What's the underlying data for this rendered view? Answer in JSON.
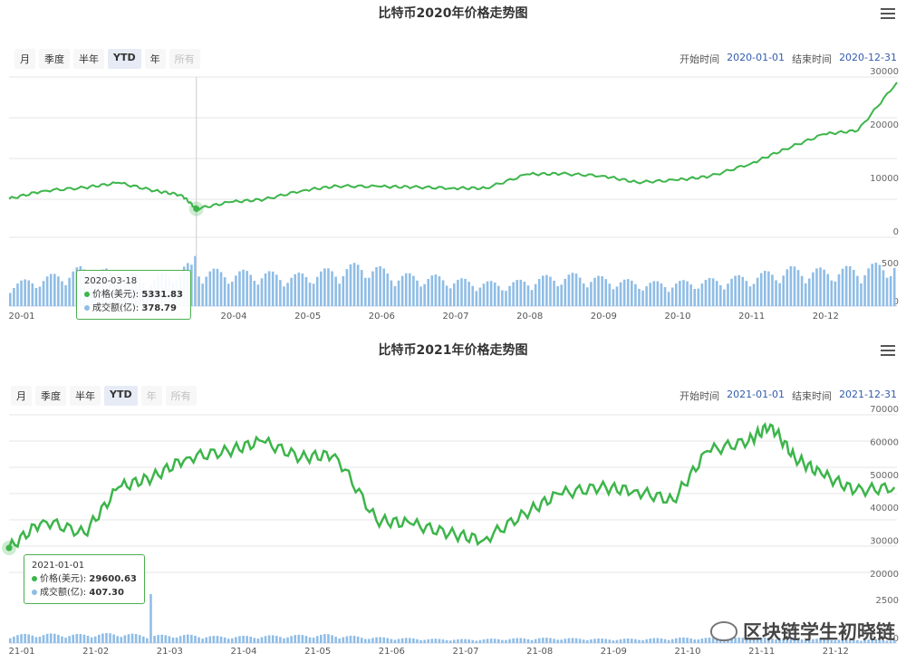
{
  "colors": {
    "price": "#3cb54a",
    "volume": "#8fbde6",
    "accent": "#335cad"
  },
  "charts": [
    {
      "title": "比特币2020年价格走势图",
      "range_buttons": [
        "月",
        "季度",
        "半年",
        "YTD",
        "年",
        "所有"
      ],
      "active_button": "YTD",
      "disabled_buttons": [
        "所有"
      ],
      "start_label": "开始时间",
      "start_value": "2020-01-01",
      "end_label": "结束时间",
      "end_value": "2020-12-31",
      "tooltip": {
        "date": "2020-03-18",
        "price_label": "价格(美元):",
        "price_value": "5331.83",
        "volume_label": "成交额(亿):",
        "volume_value": "378.79"
      }
    },
    {
      "title": "比特币2021年价格走势图",
      "range_buttons": [
        "月",
        "季度",
        "半年",
        "YTD",
        "年",
        "所有"
      ],
      "active_button": "YTD",
      "disabled_buttons": [
        "年",
        "所有"
      ],
      "start_label": "开始时间",
      "start_value": "2021-01-01",
      "end_label": "结束时间",
      "end_value": "2021-12-31",
      "tooltip": {
        "date": "2021-01-01",
        "price_label": "价格(美元):",
        "price_value": "29600.63",
        "volume_label": "成交额(亿):",
        "volume_value": "407.30"
      }
    }
  ],
  "chart_data": [
    {
      "type": "line",
      "title": "比特币2020年价格走势图",
      "x": [
        "2020-01-01",
        "2020-01-15",
        "2020-02-01",
        "2020-02-15",
        "2020-03-01",
        "2020-03-12",
        "2020-03-18",
        "2020-04-01",
        "2020-04-15",
        "2020-05-01",
        "2020-05-15",
        "2020-06-01",
        "2020-06-15",
        "2020-07-01",
        "2020-07-15",
        "2020-08-01",
        "2020-08-15",
        "2020-09-01",
        "2020-09-15",
        "2020-10-01",
        "2020-10-15",
        "2020-11-01",
        "2020-11-15",
        "2020-12-01",
        "2020-12-15",
        "2020-12-31"
      ],
      "series": [
        {
          "values": [
            7200,
            8700,
            9300,
            10200,
            8700,
            7900,
            5331.83,
            6600,
            7100,
            8800,
            9600,
            9500,
            9400,
            9200,
            9200,
            11800,
            11900,
            11500,
            10300,
            10700,
            11400,
            13800,
            16500,
            19300,
            20000,
            29000
          ]
        }
      ],
      "volume_values": [
        250,
        320,
        420,
        380,
        300,
        450,
        378.79,
        380,
        340,
        400,
        470,
        350,
        330,
        280,
        250,
        320,
        350,
        300,
        260,
        270,
        300,
        340,
        420,
        400,
        430,
        480
      ],
      "ylim": [
        0,
        30000
      ],
      "price_ticks": [
        0,
        10000,
        20000,
        30000
      ],
      "volume_ticks": [
        0,
        500
      ],
      "x_tick_labels": [
        "20-01",
        "20-04",
        "20-05",
        "20-06",
        "20-07",
        "20-08",
        "20-09",
        "20-10",
        "20-11",
        "20-12"
      ]
    },
    {
      "type": "line",
      "title": "比特币2021年价格走势图",
      "x": [
        "2021-01-01",
        "2021-01-15",
        "2021-02-01",
        "2021-02-15",
        "2021-03-01",
        "2021-03-15",
        "2021-04-01",
        "2021-04-15",
        "2021-05-01",
        "2021-05-15",
        "2021-06-01",
        "2021-06-15",
        "2021-07-01",
        "2021-07-15",
        "2021-08-01",
        "2021-08-15",
        "2021-09-01",
        "2021-09-15",
        "2021-10-01",
        "2021-10-15",
        "2021-11-01",
        "2021-11-10",
        "2021-11-20",
        "2021-12-01",
        "2021-12-15",
        "2021-12-31"
      ],
      "series": [
        {
          "values": [
            29600.63,
            38000,
            34000,
            48000,
            51000,
            57000,
            59000,
            62000,
            57000,
            58000,
            38000,
            37000,
            34000,
            32000,
            40000,
            46000,
            48000,
            47000,
            44000,
            59000,
            62000,
            67000,
            57000,
            52000,
            47000,
            48000
          ]
        }
      ],
      "volume_values": [
        407.3,
        450,
        420,
        480,
        380,
        400,
        320,
        350,
        380,
        420,
        300,
        250,
        200,
        180,
        220,
        250,
        230,
        200,
        220,
        260,
        250,
        270,
        240,
        200,
        180,
        170
      ],
      "ylim": [
        20000,
        70000
      ],
      "price_ticks": [
        20000,
        30000,
        40000,
        50000,
        60000,
        70000
      ],
      "volume_ticks": [
        0,
        2500
      ],
      "x_tick_labels": [
        "21-01",
        "21-02",
        "21-03",
        "21-04",
        "21-05",
        "21-06",
        "21-07",
        "21-08",
        "21-09",
        "21-10",
        "21-11",
        "21-12"
      ]
    }
  ],
  "watermark": {
    "text": "区块链学生初晓链"
  }
}
